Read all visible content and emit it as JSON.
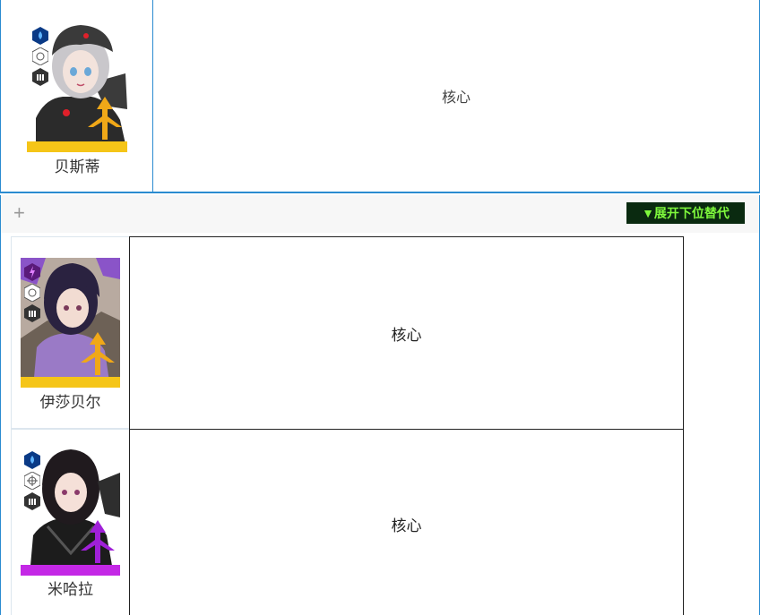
{
  "top_entry": {
    "name": "贝斯蒂",
    "role": "核心"
  },
  "expand_bar": {
    "plus": "+",
    "button_label": "▼展开下位替代"
  },
  "alternatives": [
    {
      "name": "伊莎贝尔",
      "role": "核心"
    },
    {
      "name": "米哈拉",
      "role": "核心"
    }
  ],
  "colors": {
    "frame_border": "#2a8bd0",
    "button_bg": "#0a2a10",
    "button_text": "#7ef83c",
    "gold_bar": "#f5c518",
    "purple_bar": "#c428e6"
  },
  "icons": {
    "element_water": "water-drop-icon",
    "element_electric": "lightning-icon",
    "weapon": "crosshair-icon",
    "class": "pillar-icon",
    "burst": "burst-emblem-icon"
  }
}
